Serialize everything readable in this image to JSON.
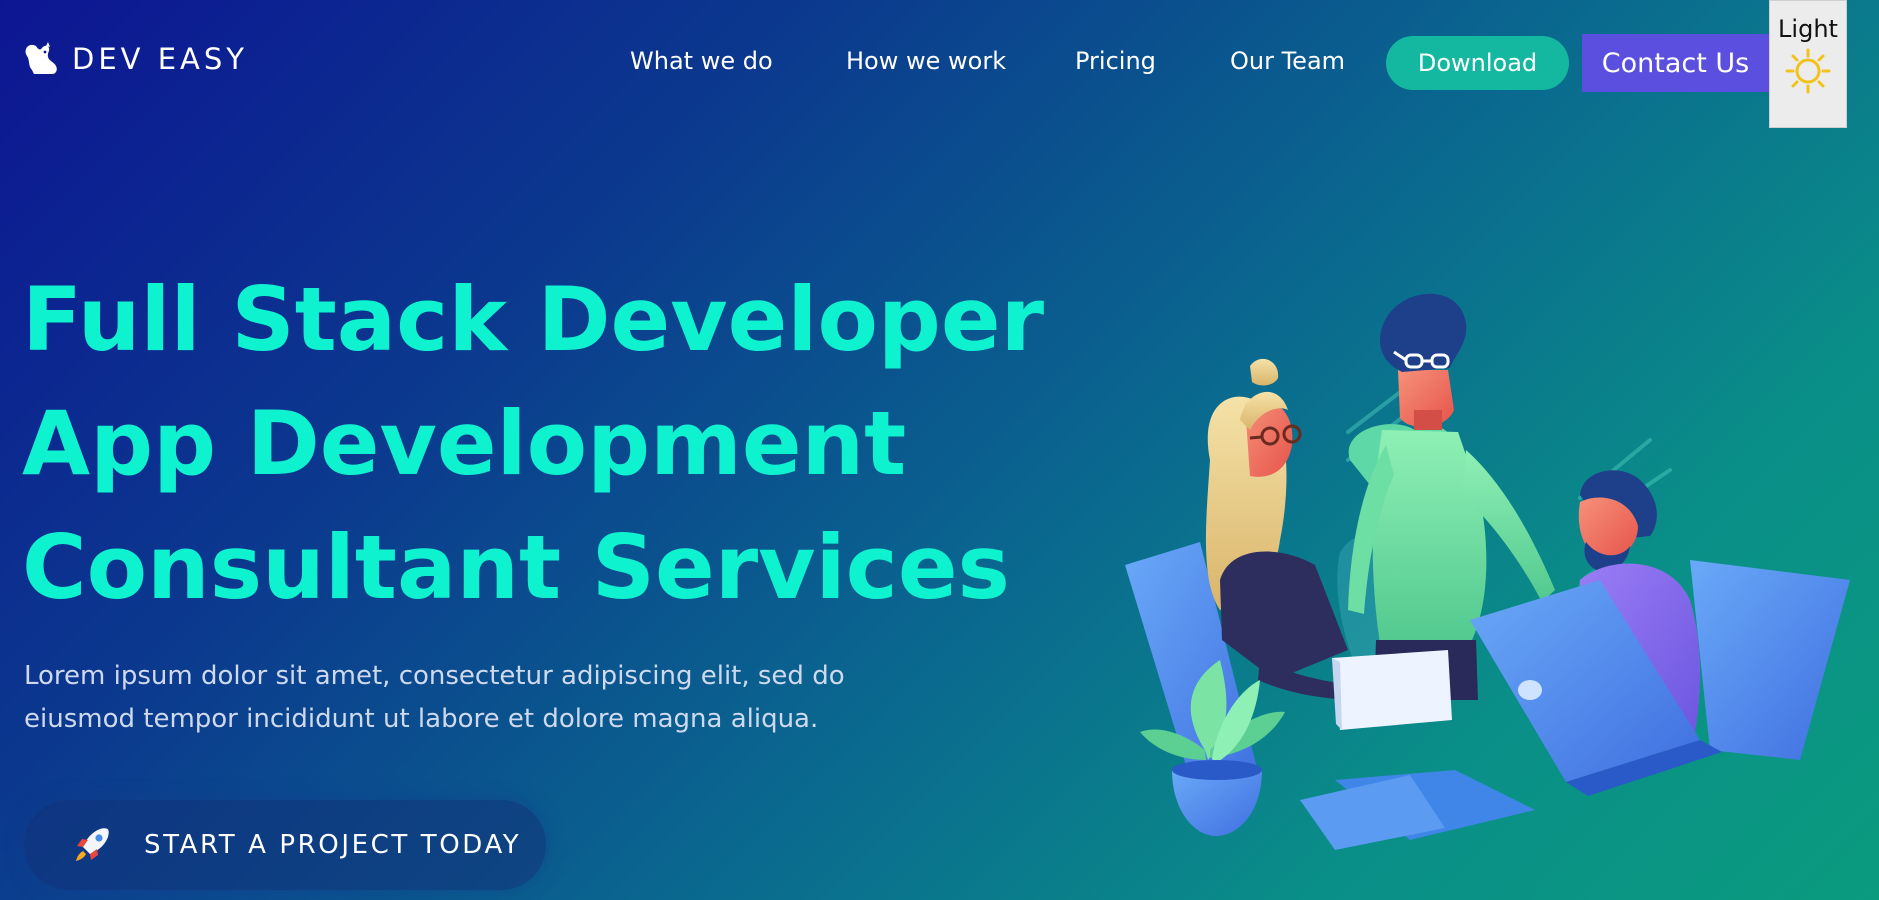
{
  "header": {
    "logo_text": "DEV EASY",
    "logo_icon": "squirrel-icon",
    "nav": {
      "what_we_do": "What we do",
      "how_we_work": "How we work",
      "pricing": "Pricing",
      "our_team": "Our Team"
    },
    "download_label": "Download",
    "contact_label": "Contact Us",
    "theme_toggle": {
      "label": "Light",
      "icon": "sun-icon"
    }
  },
  "hero": {
    "headline": {
      "line1": "Full Stack Developer",
      "line2": "App Development",
      "line3": "Consultant Services"
    },
    "subtext": "Lorem ipsum dolor sit amet, consectetur adipiscing elit, sed do eiusmod tempor incididunt ut labore et dolore magna aliqua.",
    "cta_label": "START A PROJECT TODAY",
    "cta_icon": "rocket-icon",
    "illustration": "team-meeting-illustration"
  },
  "colors": {
    "bg_start": "#0d1593",
    "bg_end": "#0a9b7f",
    "headline": "#0ff2d0",
    "download_button": "#14b8a0",
    "contact_button": "#5b4fe0",
    "sun": "#f2c21a"
  }
}
